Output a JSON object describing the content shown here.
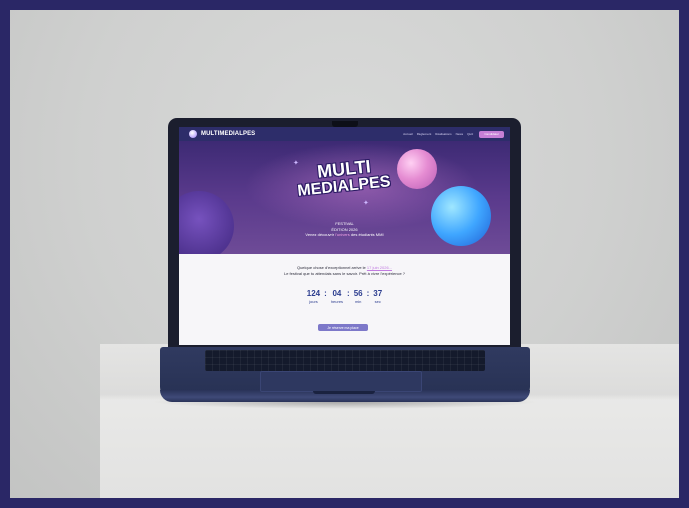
{
  "site": {
    "logo_text": "MULTIMEDIALPES",
    "nav": [
      "Accueil",
      "Règlement",
      "Réalisations",
      "News",
      "Quiz"
    ],
    "nav_cta": "Candidater"
  },
  "hero": {
    "title_line1": "MULTI",
    "title_line2": "MEDIALPES",
    "festival_label": "FESTIVAL",
    "edition_label": "ÉDITION 2026",
    "tagline_prefix": "Venez découvrir ",
    "tagline_accent": "l'univers",
    "tagline_suffix": " des étudiants MMI"
  },
  "content": {
    "intro_prefix": "Quelque chose d'exceptionnel arrive le ",
    "intro_date": "17 juin 2026...",
    "intro_line2": "Le festival que tu attendais sans le savoir. Prêt à vivre l'expérience ?"
  },
  "countdown": {
    "days": "124",
    "hours": "04",
    "minutes": "56",
    "seconds": "37",
    "days_label": "jours",
    "hours_label": "heures",
    "minutes_label": "min",
    "seconds_label": "sec",
    "separator": ":"
  },
  "cta": {
    "reserve_label": "Je réserve ma place"
  },
  "colors": {
    "frame": "#2a2766",
    "nav_bg": "#2d2d6a",
    "accent_pink": "#c77fd6",
    "countdown": "#2c3d8f",
    "button": "#7d78c9"
  }
}
